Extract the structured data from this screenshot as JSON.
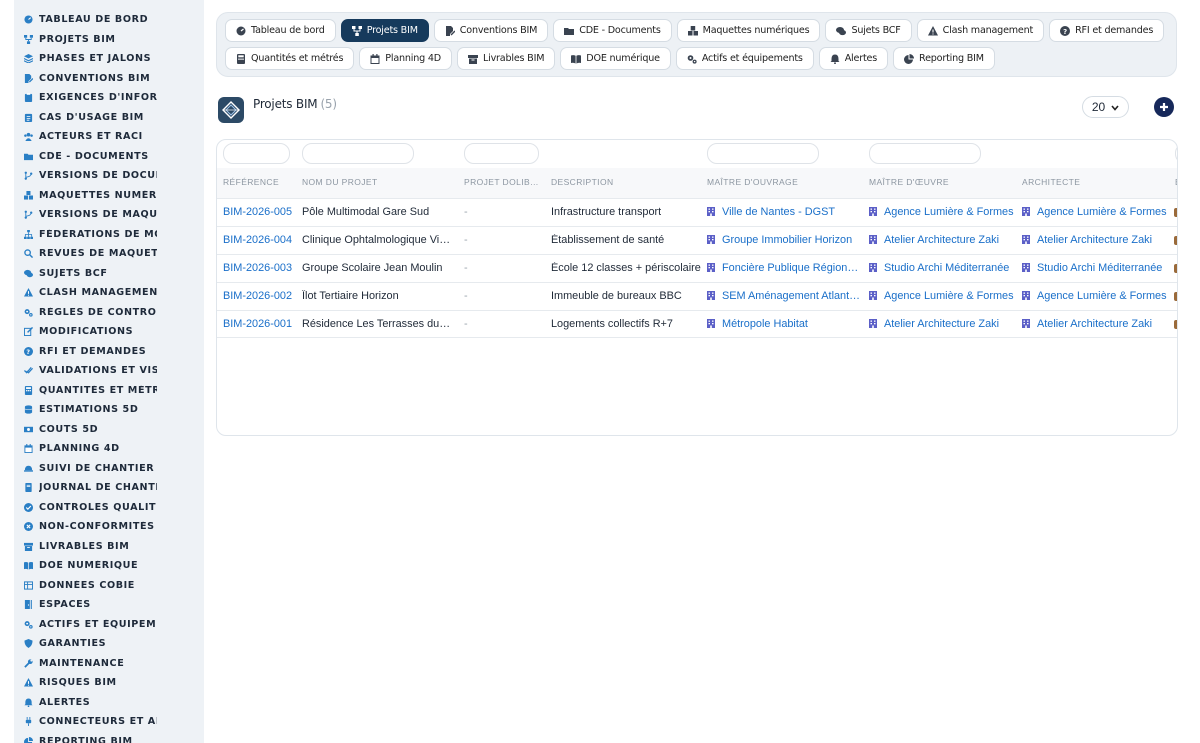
{
  "sidebar": {
    "items": [
      {
        "label": "TABLEAU DE BORD",
        "icon": "dashboard-icon"
      },
      {
        "label": "PROJETS BIM",
        "icon": "network-icon"
      },
      {
        "label": "PHASES ET JALONS",
        "icon": "layers-icon"
      },
      {
        "label": "CONVENTIONS BIM",
        "icon": "file-signature-icon"
      },
      {
        "label": "EXIGENCES D'INFORMATION",
        "icon": "clipboard-icon"
      },
      {
        "label": "CAS D'USAGE BIM",
        "icon": "clipboard-list-icon"
      },
      {
        "label": "ACTEURS ET RACI",
        "icon": "users-icon"
      },
      {
        "label": "CDE - DOCUMENTS",
        "icon": "folder-icon"
      },
      {
        "label": "VERSIONS DE DOCUMENTS",
        "icon": "branch-icon"
      },
      {
        "label": "MAQUETTES NUMÉRIQUES",
        "icon": "cubes-icon"
      },
      {
        "label": "VERSIONS DE MAQUETTES",
        "icon": "branch-icon"
      },
      {
        "label": "FÉDÉRATIONS DE MODÈLES",
        "icon": "sitemap-icon"
      },
      {
        "label": "REVUES DE MAQUETTES",
        "icon": "search-icon"
      },
      {
        "label": "SUJETS BCF",
        "icon": "comments-icon"
      },
      {
        "label": "CLASH MANAGEMENT",
        "icon": "warning-icon"
      },
      {
        "label": "RÈGLES DE CONTRÔLE",
        "icon": "gears-icon"
      },
      {
        "label": "MODIFICATIONS",
        "icon": "edit-icon"
      },
      {
        "label": "RFI ET DEMANDES",
        "icon": "question-icon"
      },
      {
        "label": "VALIDATIONS ET VISAS",
        "icon": "check-double-icon"
      },
      {
        "label": "QUANTITÉS ET MÉTRÉS",
        "icon": "calculator-icon"
      },
      {
        "label": "ESTIMATIONS 5D",
        "icon": "coins-icon"
      },
      {
        "label": "COÛTS 5D",
        "icon": "money-icon"
      },
      {
        "label": "PLANNING 4D",
        "icon": "calendar-icon"
      },
      {
        "label": "SUIVI DE CHANTIER",
        "icon": "hardhat-icon"
      },
      {
        "label": "JOURNAL DE CHANTIER",
        "icon": "book-icon"
      },
      {
        "label": "CONTRÔLES QUALITÉ",
        "icon": "check-circle-icon"
      },
      {
        "label": "NON-CONFORMITÉS",
        "icon": "times-circle-icon"
      },
      {
        "label": "LIVRABLES BIM",
        "icon": "box-icon"
      },
      {
        "label": "DOE NUMÉRIQUE",
        "icon": "book-open-icon"
      },
      {
        "label": "DONNÉES COBIE",
        "icon": "table-icon"
      },
      {
        "label": "ESPACES",
        "icon": "door-icon"
      },
      {
        "label": "ACTIFS ET ÉQUIPEMENTS",
        "icon": "gears-icon"
      },
      {
        "label": "GARANTIES",
        "icon": "shield-icon"
      },
      {
        "label": "MAINTENANCE",
        "icon": "wrench-icon"
      },
      {
        "label": "RISQUES BIM",
        "icon": "warning-icon"
      },
      {
        "label": "ALERTES",
        "icon": "bell-icon"
      },
      {
        "label": "CONNECTEURS ET API",
        "icon": "plug-icon"
      },
      {
        "label": "REPORTING BIM",
        "icon": "chart-pie-icon"
      }
    ]
  },
  "tabs": {
    "row1": [
      {
        "label": "Tableau de bord",
        "icon": "dashboard-icon",
        "active": false
      },
      {
        "label": "Projets BIM",
        "icon": "network-icon",
        "active": true
      },
      {
        "label": "Conventions BIM",
        "icon": "file-signature-icon",
        "active": false
      },
      {
        "label": "CDE - Documents",
        "icon": "folder-icon",
        "active": false
      },
      {
        "label": "Maquettes numériques",
        "icon": "cubes-icon",
        "active": false
      },
      {
        "label": "Sujets BCF",
        "icon": "comments-icon",
        "active": false
      },
      {
        "label": "Clash management",
        "icon": "warning-icon",
        "active": false
      },
      {
        "label": "RFI et demandes",
        "icon": "question-icon",
        "active": false
      }
    ],
    "row2": [
      {
        "label": "Quantités et métrés",
        "icon": "calculator-icon",
        "active": false
      },
      {
        "label": "Planning 4D",
        "icon": "calendar-icon",
        "active": false
      },
      {
        "label": "Livrables BIM",
        "icon": "box-icon",
        "active": false
      },
      {
        "label": "DOE numérique",
        "icon": "book-open-icon",
        "active": false
      },
      {
        "label": "Actifs et équipements",
        "icon": "gears-icon",
        "active": false
      },
      {
        "label": "Alertes",
        "icon": "bell-icon",
        "active": false
      },
      {
        "label": "Reporting BIM",
        "icon": "chart-pie-icon",
        "active": false
      }
    ]
  },
  "header": {
    "title": "Projets BIM",
    "count": "(5)",
    "page_size": "20"
  },
  "table": {
    "columns": [
      "RÉFÉRENCE",
      "NOM DU PROJET",
      "PROJET DOLIB…",
      "DESCRIPTION",
      "MAÎTRE D'OUVRAGE",
      "MAÎTRE D'ŒUVRE",
      "ARCHITECTE",
      "B"
    ],
    "rows": [
      {
        "ref": "BIM-2026-005",
        "name": "Pôle Multimodal Gare Sud",
        "dolibarr": "-",
        "description": "Infrastructure transport",
        "owner": "Ville de Nantes - DGST",
        "moe": "Agence Lumière & Formes",
        "architect": "Agence Lumière & Formes"
      },
      {
        "ref": "BIM-2026-004",
        "name": "Clinique Ophtalmologique Vis…",
        "dolibarr": "-",
        "description": "Établissement de santé",
        "owner": "Groupe Immobilier Horizon",
        "moe": "Atelier Architecture Zaki",
        "architect": "Atelier Architecture Zaki"
      },
      {
        "ref": "BIM-2026-003",
        "name": "Groupe Scolaire Jean Moulin",
        "dolibarr": "-",
        "description": "École 12 classes + périscolaire",
        "owner": "Foncière Publique Région…",
        "moe": "Studio Archi Méditerranée",
        "architect": "Studio Archi Méditerranée"
      },
      {
        "ref": "BIM-2026-002",
        "name": "Îlot Tertiaire Horizon",
        "dolibarr": "-",
        "description": "Immeuble de bureaux BBC",
        "owner": "SEM Aménagement Atlant…",
        "moe": "Agence Lumière & Formes",
        "architect": "Agence Lumière & Formes"
      },
      {
        "ref": "BIM-2026-001",
        "name": "Résidence Les Terrasses du …",
        "dolibarr": "-",
        "description": "Logements collectifs R+7",
        "owner": "Métropole Habitat",
        "moe": "Atelier Architecture Zaki",
        "architect": "Atelier Architecture Zaki"
      }
    ]
  },
  "colors": {
    "active_tab": "#163a5c",
    "link": "#1a6fc9",
    "sidebar_bg": "#eef2f6",
    "building_icon": "#5b5fc7"
  }
}
